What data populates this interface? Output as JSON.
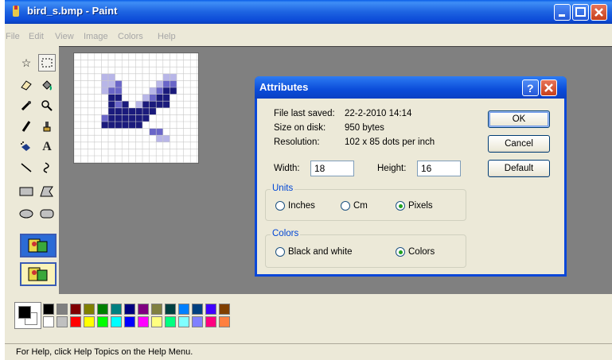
{
  "window": {
    "title": "bird_s.bmp - Paint"
  },
  "menu": [
    "File",
    "Edit",
    "View",
    "Image",
    "Colors",
    "Help"
  ],
  "status": {
    "text": "For Help, click Help Topics on the Help Menu."
  },
  "dialog": {
    "title": "Attributes",
    "info": [
      {
        "label": "File last saved:",
        "value": "22-2-2010 14:14"
      },
      {
        "label": "Size on disk:",
        "value": "950 bytes"
      },
      {
        "label": "Resolution:",
        "value": "102 x 85 dots per inch"
      }
    ],
    "width_label": "Width:",
    "width_value": "18",
    "height_label": "Height:",
    "height_value": "16",
    "units": {
      "title": "Units",
      "options": [
        "Inches",
        "Cm",
        "Pixels"
      ],
      "selected": "Pixels"
    },
    "colors": {
      "title": "Colors",
      "options": [
        "Black and white",
        "Colors"
      ],
      "selected": "Colors"
    },
    "buttons": {
      "ok": "OK",
      "cancel": "Cancel",
      "default": "Default"
    }
  },
  "palette": {
    "top": [
      "#000000",
      "#808080",
      "#800000",
      "#808000",
      "#008000",
      "#008080",
      "#000080",
      "#800080",
      "#808040",
      "#004040",
      "#0080ff",
      "#004080",
      "#4000ff",
      "#804000"
    ],
    "bottom": [
      "#ffffff",
      "#c0c0c0",
      "#ff0000",
      "#ffff00",
      "#00ff00",
      "#00ffff",
      "#0000ff",
      "#ff00ff",
      "#ffff80",
      "#00ff80",
      "#80ffff",
      "#8080ff",
      "#ff0080",
      "#ff8040"
    ],
    "foreground": "#000000",
    "background": "#ffffff"
  },
  "icons": [
    "app-paint-icon",
    "help-icon",
    "close-icon",
    "minimize-icon",
    "maximize-icon"
  ]
}
